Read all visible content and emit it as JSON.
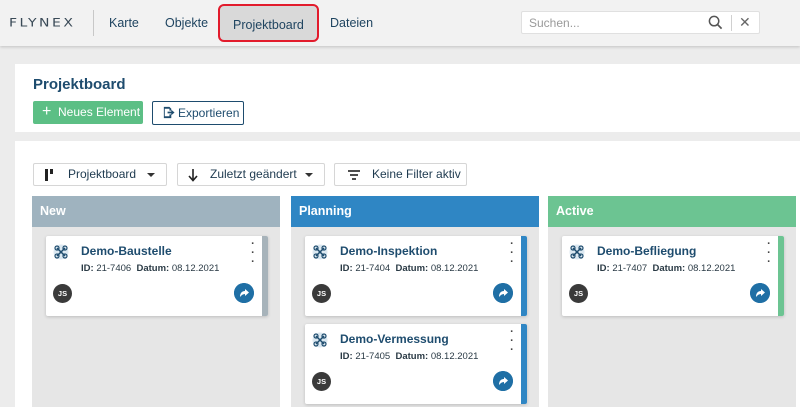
{
  "app": {
    "logo": "FLYNEX"
  },
  "nav": {
    "items": [
      {
        "label": "Karte"
      },
      {
        "label": "Objekte"
      },
      {
        "label": "Projektboard"
      },
      {
        "label": "Dateien"
      }
    ],
    "active": "Projektboard"
  },
  "search": {
    "placeholder": "Suchen...",
    "value": ""
  },
  "page": {
    "title": "Projektboard",
    "new_button": "Neues Element",
    "export_button": "Exportieren"
  },
  "toolbar": {
    "view": "Projektboard",
    "sort": "Zuletzt geändert",
    "filter": "Keine Filter aktiv"
  },
  "columns": [
    {
      "title": "New",
      "color": "#9fb3bf",
      "cards": [
        {
          "title": "Demo-Baustelle",
          "id_label": "ID:",
          "id": "21-7406",
          "date_label": "Datum:",
          "date": "08.12.2021",
          "assignee": "JS",
          "bar_color": "#a7b3ba"
        }
      ]
    },
    {
      "title": "Planning",
      "color": "#2f86c4",
      "cards": [
        {
          "title": "Demo-Inspektion",
          "id_label": "ID:",
          "id": "21-7404",
          "date_label": "Datum:",
          "date": "08.12.2021",
          "assignee": "JS",
          "bar_color": "#2f86c4"
        },
        {
          "title": "Demo-Vermessung",
          "id_label": "ID:",
          "id": "21-7405",
          "date_label": "Datum:",
          "date": "08.12.2021",
          "assignee": "JS",
          "bar_color": "#2f86c4"
        }
      ]
    },
    {
      "title": "Active",
      "color": "#6cc492",
      "cards": [
        {
          "title": "Demo-Befliegung",
          "id_label": "ID:",
          "id": "21-7407",
          "date_label": "Datum:",
          "date": "08.12.2021",
          "assignee": "JS",
          "bar_color": "#6cc492"
        }
      ]
    }
  ]
}
